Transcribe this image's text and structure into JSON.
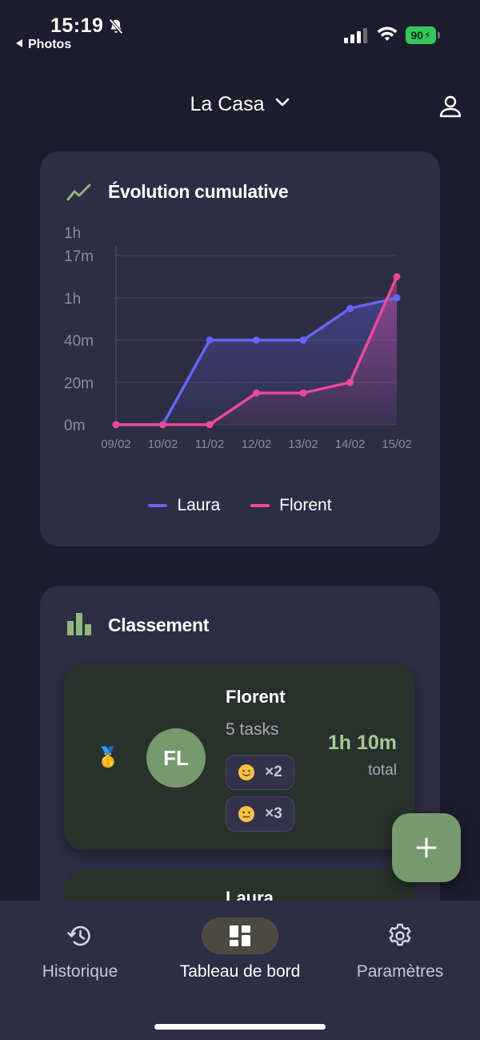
{
  "status_bar": {
    "time": "15:19",
    "back_label": "Photos",
    "battery": "90"
  },
  "header": {
    "title": "La Casa"
  },
  "chart_card": {
    "title": "Évolution cumulative",
    "chart_data": {
      "type": "area",
      "title": "Évolution cumulative",
      "categories": [
        "09/02",
        "10/02",
        "11/02",
        "12/02",
        "13/02",
        "14/02",
        "15/02"
      ],
      "y_tick_labels": [
        "0m",
        "20m",
        "40m",
        "1h",
        "1h\n17m"
      ],
      "y_unit": "minutes",
      "ylim": [
        0,
        80
      ],
      "grid": true,
      "legend_position": "bottom",
      "series": [
        {
          "name": "Laura",
          "color": "#6366f1",
          "values": [
            0,
            0,
            40,
            40,
            40,
            55,
            60
          ]
        },
        {
          "name": "Florent",
          "color": "#ec4899",
          "values": [
            0,
            0,
            0,
            15,
            15,
            20,
            70
          ]
        }
      ]
    }
  },
  "ranking_card": {
    "title": "Classement",
    "items": [
      {
        "medal": "🥇",
        "initials": "FL",
        "name": "Florent",
        "tasks": "5 tasks",
        "moods": [
          {
            "emoji": "happy",
            "count": "×2"
          },
          {
            "emoji": "neutral",
            "count": "×3"
          }
        ],
        "total": "1h 10m",
        "total_label": "total"
      },
      {
        "name": "Laura"
      }
    ]
  },
  "bottom_nav": {
    "items": [
      {
        "label": "Historique",
        "icon": "history-icon"
      },
      {
        "label": "Tableau de bord",
        "icon": "dashboard-icon",
        "active": true
      },
      {
        "label": "Paramètres",
        "icon": "settings-icon"
      }
    ]
  },
  "colors": {
    "background": "#1c1c2e",
    "card": "#2d2d44",
    "accent_green": "#77996f",
    "laura": "#6366f1",
    "florent": "#ec4899"
  }
}
